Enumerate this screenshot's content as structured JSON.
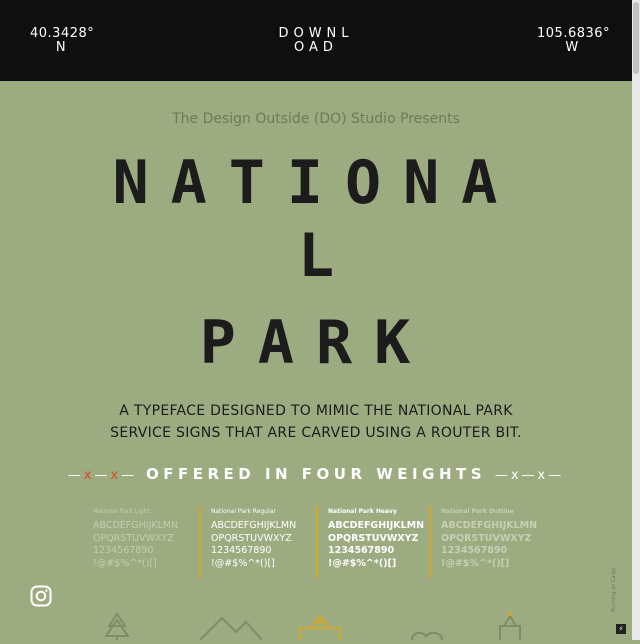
{
  "header": {
    "latitude": {
      "value": "40.3428°",
      "hemisphere": "N"
    },
    "download": {
      "line1": "DOWNL",
      "line2": "OAD"
    },
    "longitude": {
      "value": "105.6836°",
      "hemisphere": "W"
    }
  },
  "hero": {
    "presents": "The Design Outside (DO) Studio Presents",
    "title_line1": "NATIONA",
    "title_line2": "L",
    "title_line3": "PARK",
    "description": "A TYPEFACE DESIGNED TO MIMIC THE NATIONAL PARK SERVICE SIGNS THAT ARE CARVED USING A ROUTER BIT."
  },
  "offered": {
    "text": "OFFERED IN FOUR WEIGHTS",
    "left_deco_dash1": "—",
    "left_deco_x1": "x",
    "left_deco_dash2": "—",
    "left_deco_x2": "x",
    "left_deco_dash3": "—",
    "right_deco": "—x—x—"
  },
  "weights": [
    {
      "name": "National Park Light",
      "line1": "ABCDEFGHIJKLMN",
      "line2": "OPQRSTUVWXYZ",
      "line3": "1234567890",
      "line4": "!@#$%^*()[]"
    },
    {
      "name": "National Park Regular",
      "line1": "ABCDEFGHIJKLMN",
      "line2": "OPQRSTUVWXYZ",
      "line3": "1234567890",
      "line4": "!@#$%^*()[]"
    },
    {
      "name": "National Park Heavy",
      "line1": "ABCDEFGHIJKLMN",
      "line2": "OPQRSTUVWXYZ",
      "line3": "1234567890",
      "line4": "!@#$%^*()[]"
    },
    {
      "name": "National Park Outline",
      "line1": "ABCDEFGHIJKLMN",
      "line2": "OPQRSTUVWXYZ",
      "line3": "1234567890",
      "line4": "!@#$%^*()[]"
    }
  ],
  "footer": {
    "social_icon": "instagram-icon",
    "vertical_tag": "Running on Cargo",
    "bolt_icon": "lightning-icon",
    "illustration_icons": [
      "tree-icon",
      "mountains-icon",
      "sign-icon",
      "heart-icon",
      "lantern-icon"
    ]
  },
  "colors": {
    "background": "#9cab80",
    "header_bg": "#0f0f0f",
    "title": "#1c1c1c",
    "accent_red": "#d94a28",
    "accent_gold": "#d3a82a"
  }
}
